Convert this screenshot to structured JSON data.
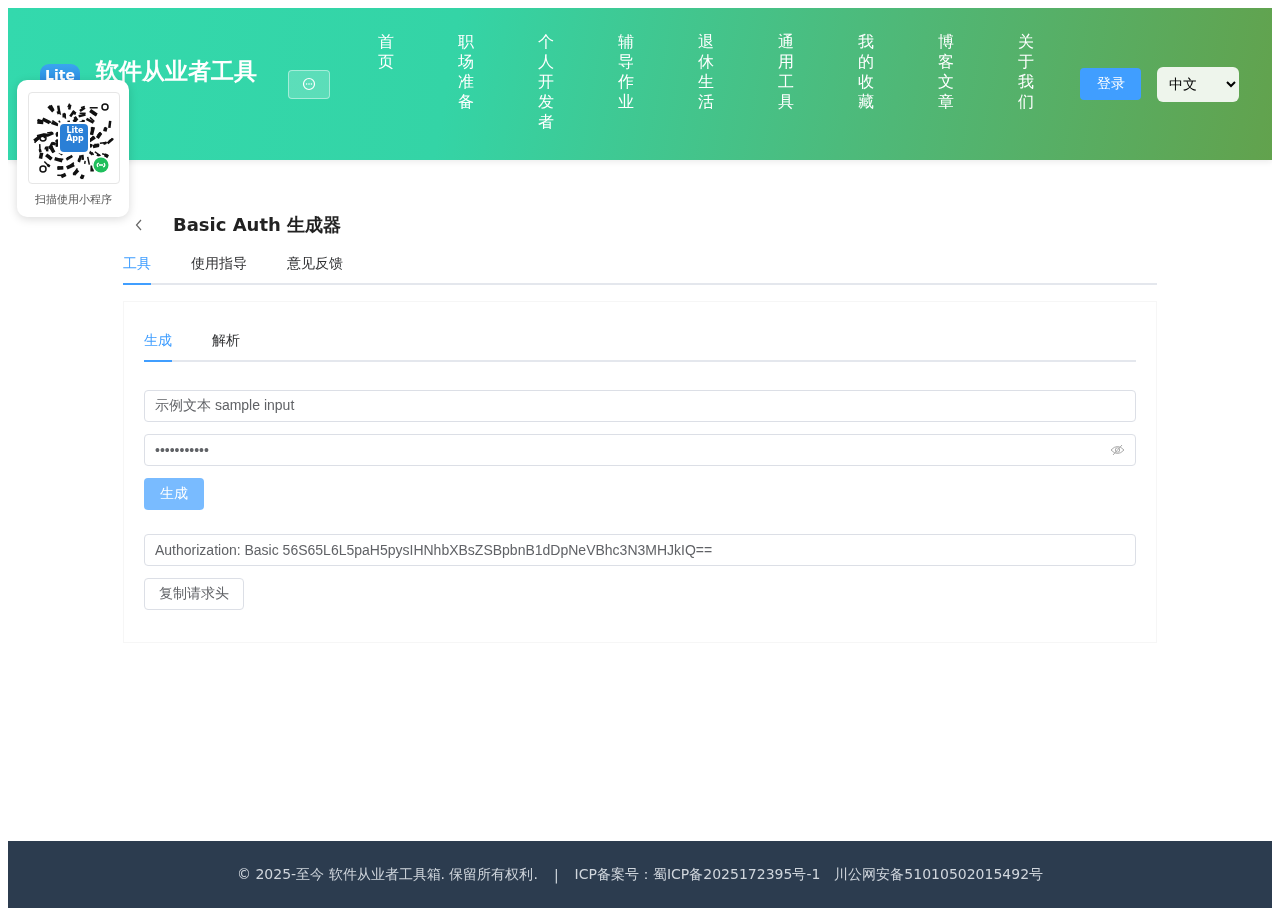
{
  "header": {
    "logo_text": "Lite",
    "site_title": "软件从业者工具",
    "nav": [
      "首页",
      "职场准备",
      "个人开发者",
      "辅导作业",
      "退休生活",
      "通用工具",
      "我的收藏",
      "博客文章",
      "关于我们"
    ],
    "login_button": "登录",
    "language": "中文"
  },
  "qr_popup": {
    "badge_lines": [
      "Lite",
      "App"
    ],
    "caption": "扫描使用小程序"
  },
  "page": {
    "title": "Basic Auth 生成器",
    "tabs": [
      {
        "label": "工具",
        "selected": true
      },
      {
        "label": "使用指导",
        "selected": false
      },
      {
        "label": "意见反馈",
        "selected": false
      }
    ],
    "sub_tabs": [
      {
        "label": "生成",
        "selected": true
      },
      {
        "label": "解析",
        "selected": false
      }
    ],
    "username": {
      "value": "示例文本 sample input"
    },
    "password": {
      "value": "•••••••••••"
    },
    "generate_button": {
      "label": "生成",
      "disabled": true
    },
    "output": {
      "value": "Authorization: Basic 56S65L6L5paH5pysIHNhbXBsZSBpbnB1dDpNeVBhc3N3MHJkIQ=="
    },
    "copy_button": "复制请求头"
  },
  "footer": {
    "copyright": "© 2025-至今 软件从业者工具箱. 保留所有权利.",
    "separator": "|",
    "icp": "ICP备案号：蜀ICP备2025172395号-1",
    "police": "川公网安备51010502015492号"
  }
}
